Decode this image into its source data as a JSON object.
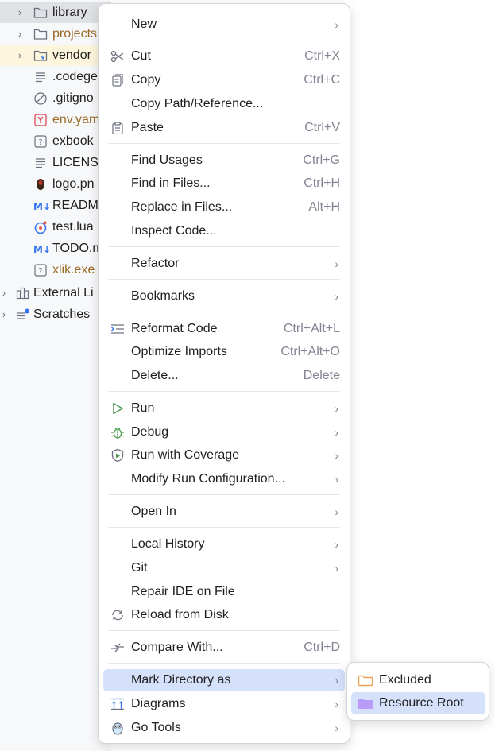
{
  "tree": {
    "items": [
      {
        "label": "library",
        "color": "dark"
      },
      {
        "label": "projects",
        "color": "brown"
      },
      {
        "label": "vendor",
        "color": "dark"
      },
      {
        "label": ".codege",
        "color": "dark"
      },
      {
        "label": ".gitigno",
        "color": "dark"
      },
      {
        "label": "env.yam",
        "color": "brown"
      },
      {
        "label": "exbook",
        "color": "dark"
      },
      {
        "label": "LICENS",
        "color": "dark"
      },
      {
        "label": "logo.pn",
        "color": "dark"
      },
      {
        "label": "READM",
        "color": "dark"
      },
      {
        "label": "test.lua",
        "color": "dark"
      },
      {
        "label": "TODO.m",
        "color": "dark"
      },
      {
        "label": "xlik.exe",
        "color": "brown"
      },
      {
        "label": "External Li",
        "color": "dark"
      },
      {
        "label": "Scratches",
        "color": "dark"
      }
    ]
  },
  "menu": {
    "new": {
      "label": "New"
    },
    "cut": {
      "label": "Cut",
      "shortcut": "Ctrl+X"
    },
    "copy": {
      "label": "Copy",
      "shortcut": "Ctrl+C"
    },
    "copy_path": {
      "label": "Copy Path/Reference..."
    },
    "paste": {
      "label": "Paste",
      "shortcut": "Ctrl+V"
    },
    "find_usages": {
      "label": "Find Usages",
      "shortcut": "Ctrl+G"
    },
    "find_in_files": {
      "label": "Find in Files...",
      "shortcut": "Ctrl+H"
    },
    "replace_in_files": {
      "label": "Replace in Files...",
      "shortcut": "Alt+H"
    },
    "inspect_code": {
      "label": "Inspect Code..."
    },
    "refactor": {
      "label": "Refactor"
    },
    "bookmarks": {
      "label": "Bookmarks"
    },
    "reformat_code": {
      "label": "Reformat Code",
      "shortcut": "Ctrl+Alt+L"
    },
    "optimize_imports": {
      "label": "Optimize Imports",
      "shortcut": "Ctrl+Alt+O"
    },
    "delete": {
      "label": "Delete...",
      "shortcut": "Delete"
    },
    "run": {
      "label": "Run"
    },
    "debug": {
      "label": "Debug"
    },
    "run_coverage": {
      "label": "Run with Coverage"
    },
    "modify_run": {
      "label": "Modify Run Configuration..."
    },
    "open_in": {
      "label": "Open In"
    },
    "local_history": {
      "label": "Local History"
    },
    "git": {
      "label": "Git"
    },
    "repair_ide": {
      "label": "Repair IDE on File"
    },
    "reload_disk": {
      "label": "Reload from Disk"
    },
    "compare_with": {
      "label": "Compare With...",
      "shortcut": "Ctrl+D"
    },
    "mark_directory": {
      "label": "Mark Directory as"
    },
    "diagrams": {
      "label": "Diagrams"
    },
    "go_tools": {
      "label": "Go Tools"
    }
  },
  "submenu": {
    "excluded": {
      "label": "Excluded"
    },
    "resource_root": {
      "label": "Resource Root"
    }
  },
  "colors": {
    "highlight": "#d5e1fb",
    "folder_orange": "#f0a35b",
    "folder_purple": "#b99bf8",
    "run_green": "#4c9a51"
  }
}
